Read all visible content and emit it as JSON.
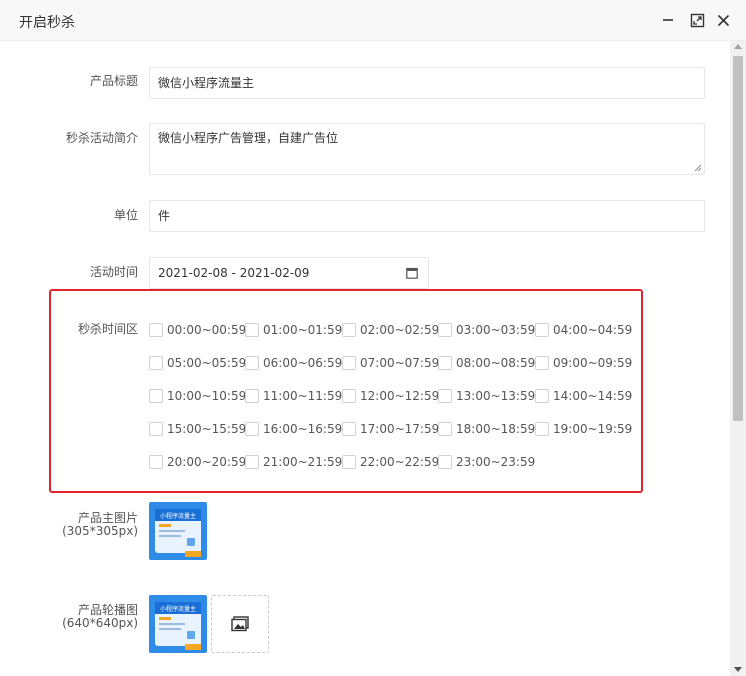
{
  "dialog": {
    "title": "开启秒杀"
  },
  "form": {
    "product_title": {
      "label": "产品标题",
      "value": "微信小程序流量主"
    },
    "intro": {
      "label": "秒杀活动简介",
      "value": "微信小程序广告管理，自建广告位"
    },
    "unit": {
      "label": "单位",
      "value": "件"
    },
    "activity_time": {
      "label": "活动时间",
      "value": "2021-02-08 - 2021-02-09"
    },
    "time_slots": {
      "label": "秒杀时间区",
      "items": [
        "00:00~00:59",
        "01:00~01:59",
        "02:00~02:59",
        "03:00~03:59",
        "04:00~04:59",
        "05:00~05:59",
        "06:00~06:59",
        "07:00~07:59",
        "08:00~08:59",
        "09:00~09:59",
        "10:00~10:59",
        "11:00~11:59",
        "12:00~12:59",
        "13:00~13:59",
        "14:00~14:59",
        "15:00~15:59",
        "16:00~16:59",
        "17:00~17:59",
        "18:00~18:59",
        "19:00~19:59",
        "20:00~20:59",
        "21:00~21:59",
        "22:00~22:59",
        "23:00~23:59"
      ]
    },
    "main_image": {
      "label": "产品主图片",
      "hint": "(305*305px)",
      "thumb_title": "小程序流量主"
    },
    "carousel": {
      "label": "产品轮播图",
      "hint": "(640*640px)",
      "thumb_title": "小程序流量主"
    }
  },
  "colors": {
    "highlight_border": "#e3262e",
    "thumb_blue": "#2f8be8",
    "thumb_orange": "#f5a623"
  },
  "icons": {
    "minimize": "minimize-icon",
    "maximize": "maximize-icon",
    "close": "close-icon",
    "calendar": "calendar-icon",
    "image": "image-icon"
  }
}
